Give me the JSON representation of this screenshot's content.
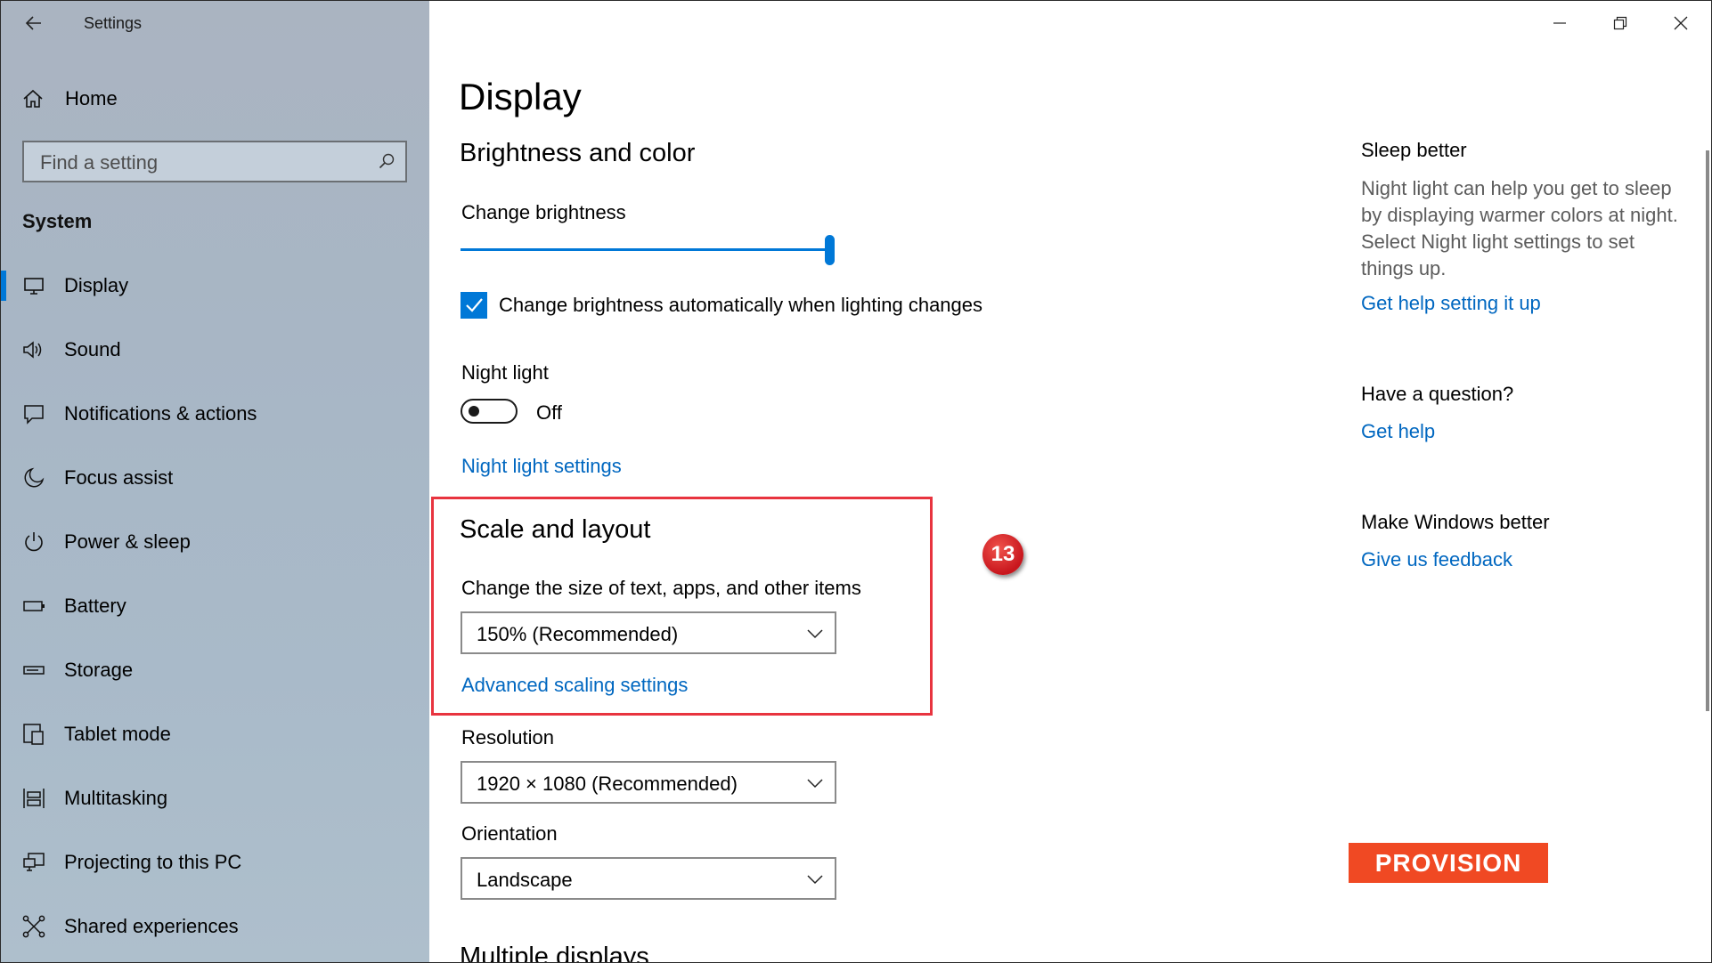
{
  "window": {
    "title": "Settings"
  },
  "sidebar": {
    "home_label": "Home",
    "search_placeholder": "Find a setting",
    "section": "System",
    "items": [
      {
        "label": "Display",
        "icon": "monitor-icon",
        "active": true
      },
      {
        "label": "Sound",
        "icon": "speaker-icon"
      },
      {
        "label": "Notifications & actions",
        "icon": "message-icon"
      },
      {
        "label": "Focus assist",
        "icon": "moon-icon"
      },
      {
        "label": "Power & sleep",
        "icon": "power-icon"
      },
      {
        "label": "Battery",
        "icon": "battery-icon"
      },
      {
        "label": "Storage",
        "icon": "storage-icon"
      },
      {
        "label": "Tablet mode",
        "icon": "tablet-mode-icon"
      },
      {
        "label": "Multitasking",
        "icon": "multitasking-icon"
      },
      {
        "label": "Projecting to this PC",
        "icon": "projecting-icon"
      },
      {
        "label": "Shared experiences",
        "icon": "shared-icon"
      }
    ]
  },
  "main": {
    "title": "Display",
    "brightness_heading": "Brightness and color",
    "brightness_label": "Change brightness",
    "brightness_value": 100,
    "auto_brightness_label": "Change brightness automatically when lighting changes",
    "auto_brightness_checked": true,
    "night_light_label": "Night light",
    "night_light_state": "Off",
    "night_light_settings_link": "Night light settings",
    "scale_heading": "Scale and layout",
    "scale_label": "Change the size of text, apps, and other items",
    "scale_value": "150% (Recommended)",
    "advanced_scaling_link": "Advanced scaling settings",
    "resolution_label": "Resolution",
    "resolution_value": "1920 × 1080 (Recommended)",
    "orientation_label": "Orientation",
    "orientation_value": "Landscape",
    "multiple_displays_heading": "Multiple displays"
  },
  "related": {
    "sleep_heading": "Sleep better",
    "sleep_text": "Night light can help you get to sleep by displaying warmer colors at night. Select Night light settings to set things up.",
    "sleep_link": "Get help setting it up",
    "question_heading": "Have a question?",
    "question_link": "Get help",
    "feedback_heading": "Make Windows better",
    "feedback_link": "Give us feedback"
  },
  "annotation": {
    "step_number": "13",
    "highlight_color": "#e8343f"
  },
  "logo": {
    "text": "PROVISION",
    "color": "#f04923"
  },
  "colors": {
    "accent": "#0078d7",
    "link": "#0067c0"
  }
}
